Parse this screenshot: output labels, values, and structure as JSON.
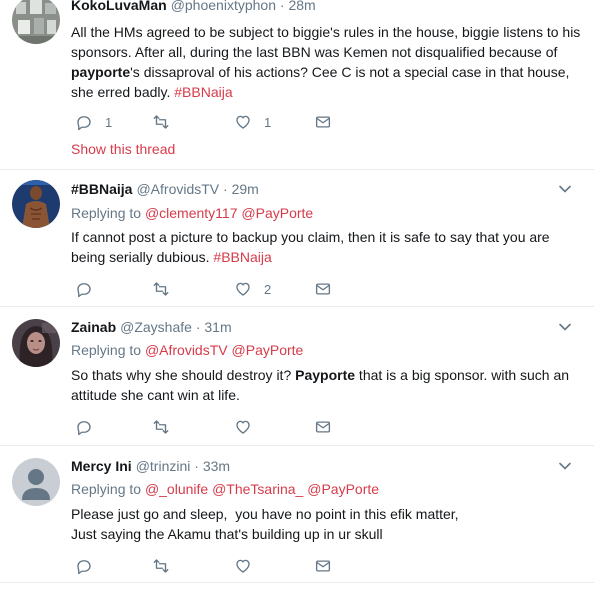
{
  "tweets": [
    {
      "fullname": "KokoLuvaMan",
      "handle": "@phoenixtyphon",
      "time": "28m",
      "text_parts": [
        {
          "t": "All the HMs agreed to be subject to biggie's rules in the house, biggie listens to his sponsors. After all, during the last BBN was Kemen not disqualified because of ",
          "s": "plain"
        },
        {
          "t": "payporte",
          "s": "bold"
        },
        {
          "t": "'s dissaproval of his actions? Cee C is not a special case in that house, she erred badly. ",
          "s": "plain"
        },
        {
          "t": "#BBNaija",
          "s": "tag"
        }
      ],
      "replies": "1",
      "retweets": "",
      "likes": "1",
      "show_thread": "Show this thread"
    },
    {
      "fullname": "#BBNaija",
      "handle": "@AfrovidsTV",
      "time": "29m",
      "replying_label": "Replying to",
      "replying_to": [
        "@clementy117",
        "@PayPorte"
      ],
      "text_parts": [
        {
          "t": "If cannot post a picture to backup you claim, then it is safe to say that you are being serially dubious. ",
          "s": "plain"
        },
        {
          "t": "#BBNaija",
          "s": "tag"
        }
      ],
      "replies": "",
      "retweets": "",
      "likes": "2"
    },
    {
      "fullname": "Zainab",
      "handle": "@Zayshafe",
      "time": "31m",
      "replying_label": "Replying to",
      "replying_to": [
        "@AfrovidsTV",
        "@PayPorte"
      ],
      "text_parts": [
        {
          "t": "So thats why she should destroy it? ",
          "s": "plain"
        },
        {
          "t": "Payporte",
          "s": "bold"
        },
        {
          "t": " that is a big sponsor. with such an attitude she cant win at life.",
          "s": "plain"
        }
      ],
      "replies": "",
      "retweets": "",
      "likes": ""
    },
    {
      "fullname": "Mercy Ini",
      "handle": "@trinzini",
      "time": "33m",
      "replying_label": "Replying to",
      "replying_to": [
        "@_olunife",
        "@TheTsarina_",
        "@PayPorte"
      ],
      "text_lines": [
        "Please just go and sleep,  you have no point in this efik matter,",
        "Just saying the Akamu that's building up in ur skull"
      ],
      "replies": "",
      "retweets": "",
      "likes": ""
    }
  ],
  "icons": {
    "reply": "reply-icon",
    "retweet": "retweet-icon",
    "like": "heart-icon",
    "dm": "envelope-icon",
    "caret": "chevron-down-icon"
  },
  "colors": {
    "accent": "#d73b4a",
    "secondary_text": "#657786",
    "border": "#e6ecf0"
  }
}
